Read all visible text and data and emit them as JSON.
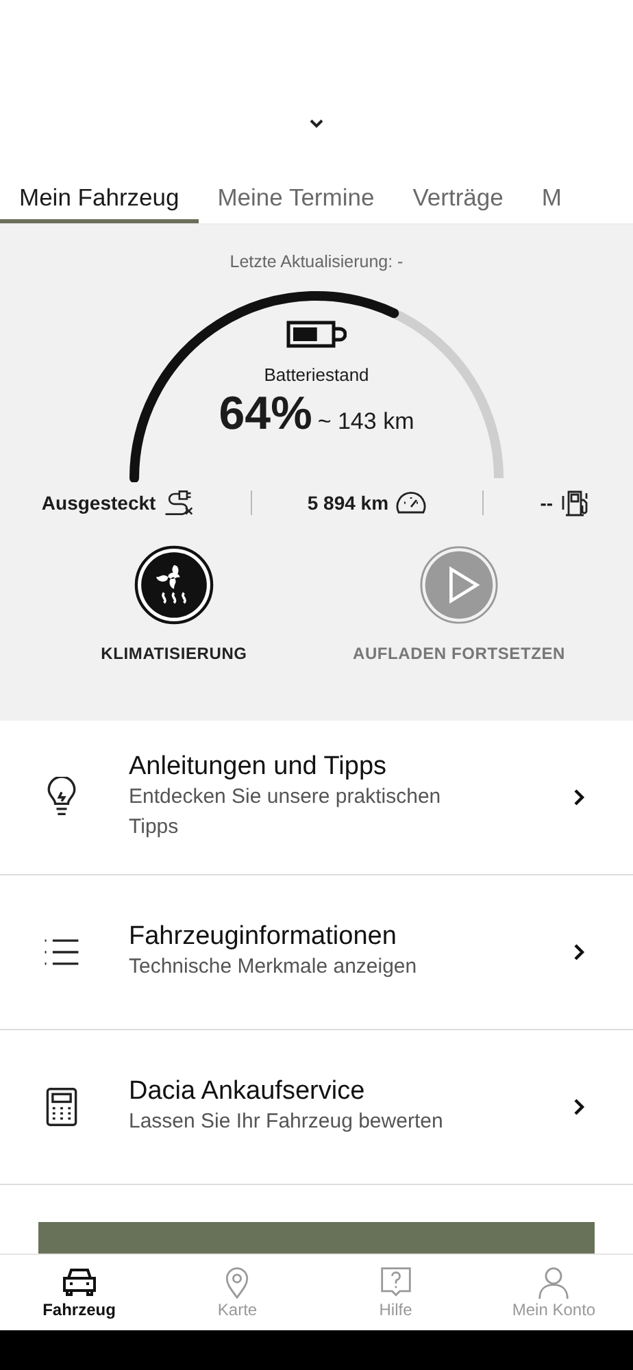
{
  "tabs": [
    {
      "label": "Mein Fahrzeug",
      "selected": true
    },
    {
      "label": "Meine Termine",
      "selected": false
    },
    {
      "label": "Verträge",
      "selected": false
    },
    {
      "label": "M",
      "selected": false
    }
  ],
  "hero": {
    "last_update": "Letzte Aktualisierung:  -",
    "battery_label": "Batteriestand",
    "percent": "64%",
    "range": "~ 143 km",
    "stats": [
      {
        "kind": "plug",
        "text": "Ausgesteckt"
      },
      {
        "kind": "odometer",
        "text": "5 894 km"
      },
      {
        "kind": "fuel",
        "text": "--"
      }
    ],
    "actions": [
      {
        "kind": "climate",
        "label": "KLIMATISIERUNG",
        "disabled": false
      },
      {
        "kind": "play",
        "label": "AUFLADEN FORTSETZEN",
        "disabled": true
      }
    ]
  },
  "menu": [
    {
      "kind": "bulb",
      "title": "Anleitungen und Tipps",
      "subtitle": "Entdecken Sie unsere praktischen Tipps"
    },
    {
      "kind": "list",
      "title": "Fahrzeuginformationen",
      "subtitle": "Technische Merkmale anzeigen"
    },
    {
      "kind": "calculator",
      "title": "Dacia Ankaufservice",
      "subtitle": "Lassen Sie Ihr Fahrzeug bewerten"
    }
  ],
  "nav": [
    {
      "kind": "car",
      "label": "Fahrzeug",
      "selected": true
    },
    {
      "kind": "pin",
      "label": "Karte",
      "selected": false
    },
    {
      "kind": "help",
      "label": "Hilfe",
      "selected": false
    },
    {
      "kind": "person",
      "label": "Mein Konto",
      "selected": false
    }
  ]
}
